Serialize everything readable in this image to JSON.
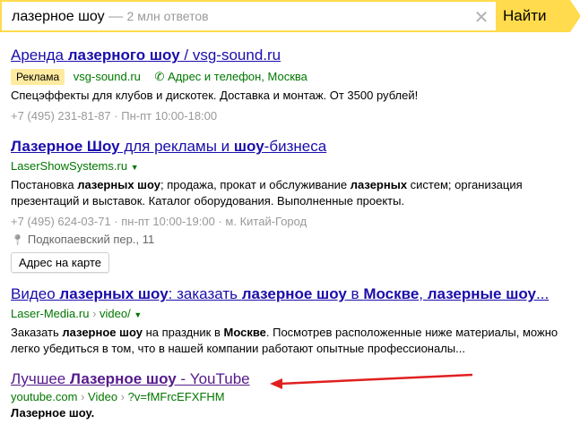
{
  "search": {
    "query": "лазерное шоу",
    "separator": "—",
    "hint": "2 млн ответов",
    "button_label": "Найти"
  },
  "results": [
    {
      "title_parts": [
        "Аренда ",
        "лазерного шоу",
        " / vsg-sound.ru"
      ],
      "ad_badge": "Реклама",
      "domain": "vsg-sound.ru",
      "contact": "Адрес и телефон, Москва",
      "snippet": "Спецэффекты для клубов и дискотек. Доставка и монтаж. От 3500 рублей!",
      "phone": "+7 (495) 231-81-87",
      "dot": "·",
      "hours": "Пн-пт 10:00-18:00"
    },
    {
      "title_parts": [
        "Лазерное Шоу",
        " для рекламы и ",
        "шоу",
        "-бизнеса"
      ],
      "domain": "LaserShowSystems.ru",
      "snippet_parts": [
        "Постановка ",
        "лазерных шоу",
        "; продажа, прокат и обслуживание ",
        "лазерных",
        " систем; организация презентаций и выставок. Каталог оборудования. Выполненные проекты."
      ],
      "phone": "+7 (495) 624-03-71",
      "dot": "·",
      "hours": "пн-пт 10:00-19:00",
      "metro": "м. Китай-Город",
      "address": "Подкопаевский пер., 11",
      "map_button": "Адрес на карте"
    },
    {
      "title_parts": [
        "Видео ",
        "лазерных шоу",
        ": заказать ",
        "лазерное шоу",
        " в ",
        "Москве",
        ", ",
        "лазерные шоу",
        "..."
      ],
      "domain": "Laser-Media.ru",
      "path": "video/",
      "path_sep": "›",
      "snippet_parts": [
        "Заказать ",
        "лазерное шоу",
        " на праздник в ",
        "Москве",
        ". Посмотрев расположенные ниже материалы, можно легко убедиться в том, что в нашей компании работают опытные профессионалы..."
      ]
    },
    {
      "title_parts": [
        "Лучшее ",
        "Лазерное шоу",
        " - YouTube"
      ],
      "domain": "youtube.com",
      "path1": "Video",
      "path2": "?v=fMFrcEFXFHM",
      "path_sep": "›",
      "snippet": "Лазерное шоу."
    }
  ],
  "annotation": {
    "arrow_color": "#e02020"
  },
  "colors": {
    "accent": "#ffdb4d",
    "link": "#1a0dab",
    "visited": "#551a8b",
    "url": "#007700"
  }
}
